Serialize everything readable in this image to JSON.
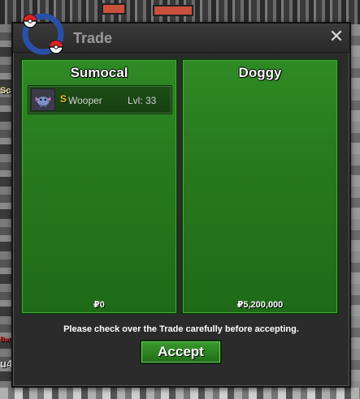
{
  "window": {
    "title": "Trade",
    "close_glyph": "✕"
  },
  "background": {
    "fragment_left_top": "Sc",
    "fragment_left_mid": "Bat",
    "fragment_left_bottom": "u4"
  },
  "traders": [
    {
      "name": "Sumocal",
      "money": "₽0",
      "items": [
        {
          "shiny_marker": "S",
          "pokemon": "Wooper",
          "level": "Lvl: 33",
          "icon": "wooper-sprite"
        }
      ]
    },
    {
      "name": "Doggy",
      "money": "₽5,200,000",
      "items": []
    }
  ],
  "notice": "Please check over the Trade carefully before accepting.",
  "actions": {
    "accept_label": "Accept"
  },
  "colors": {
    "panel_green": "#2f8a24",
    "shiny_gold": "#f2c21a",
    "dialog_bg": "#2b2b2b"
  }
}
